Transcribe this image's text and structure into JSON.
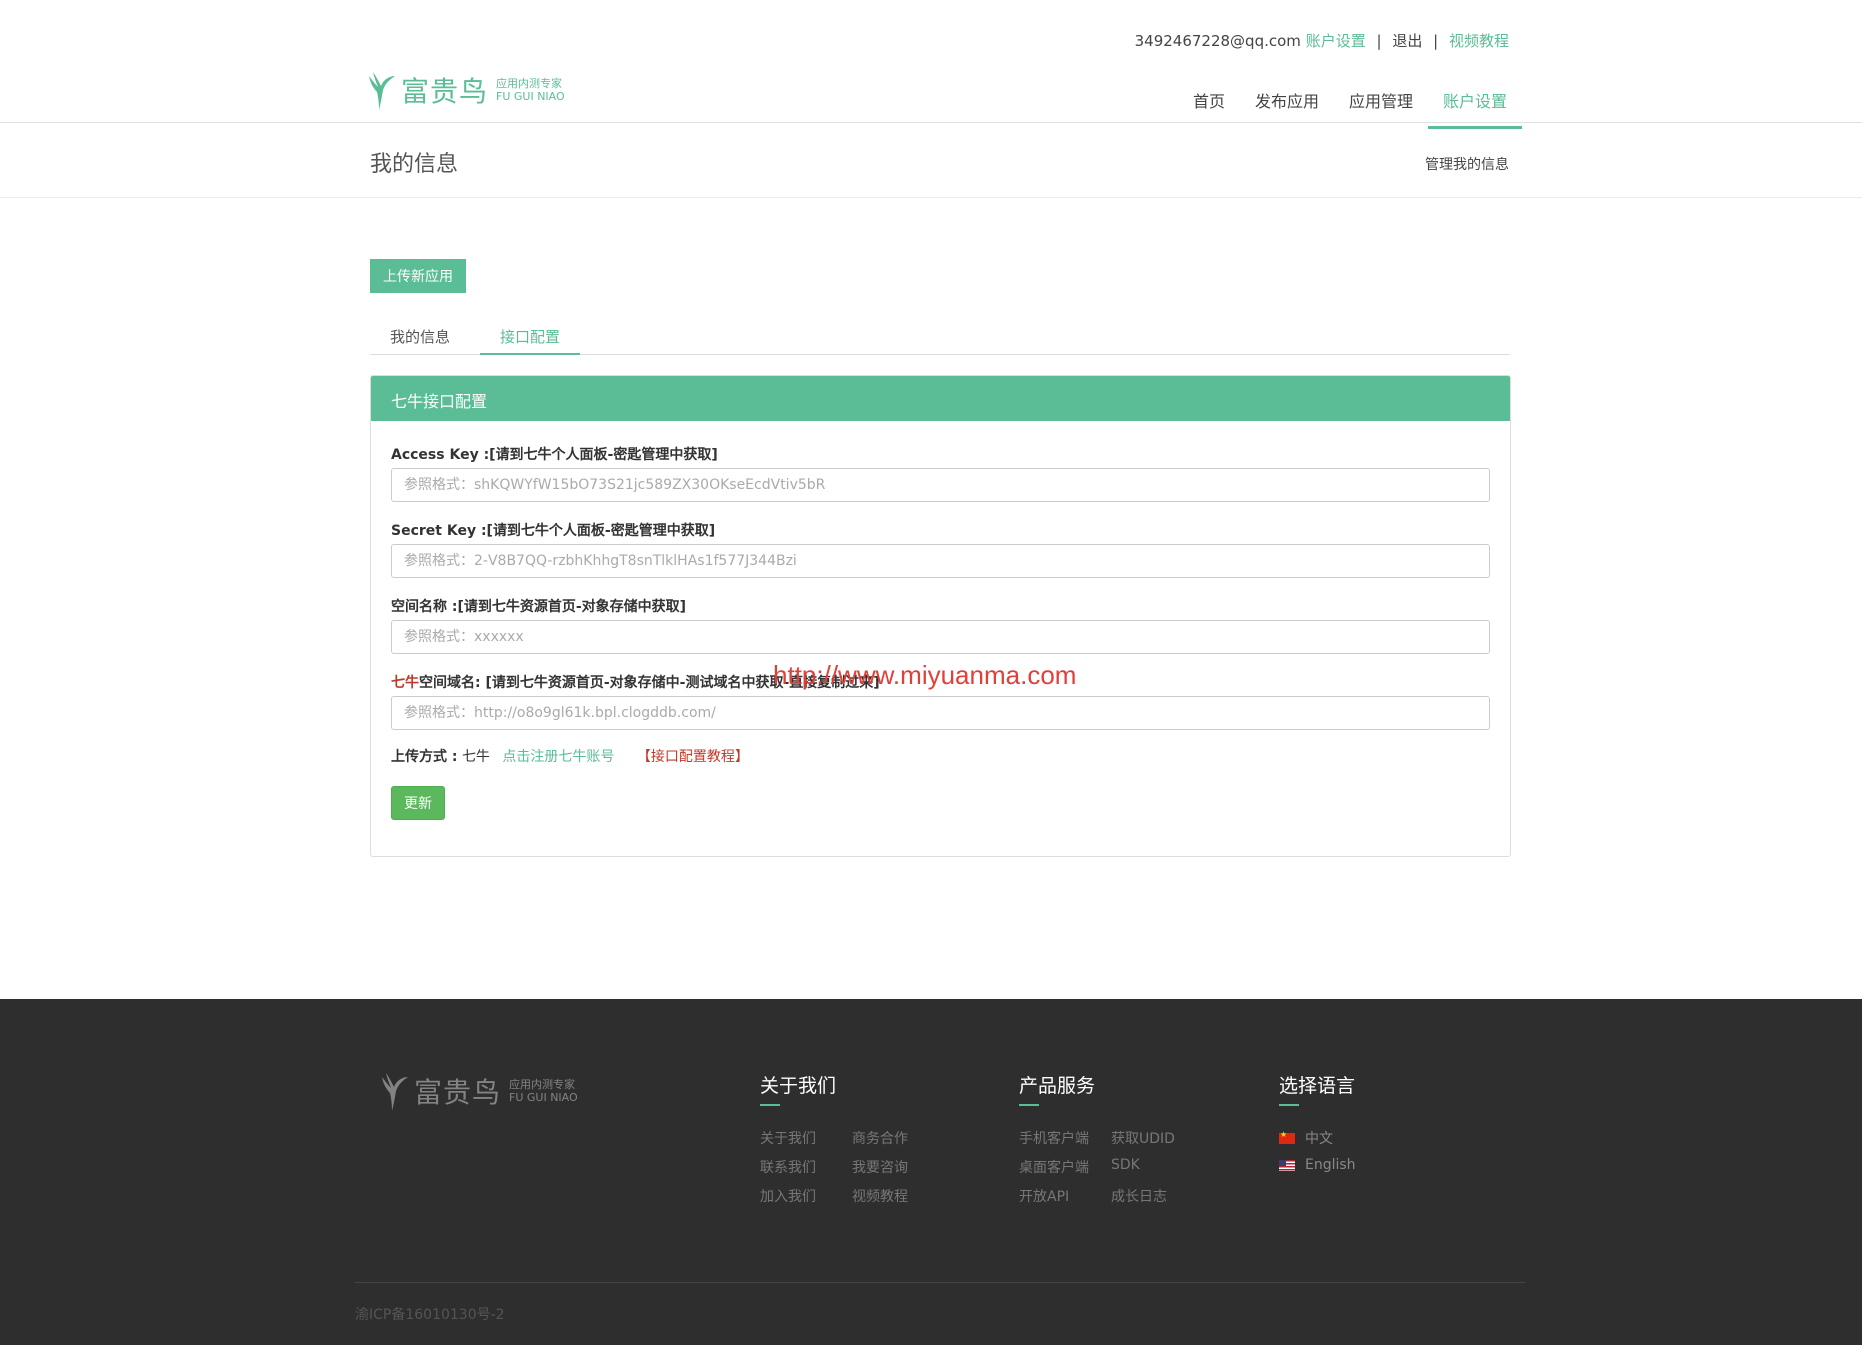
{
  "header": {
    "email": "3492467228@qq.com",
    "account_settings": "账户设置",
    "logout": "退出",
    "video_tutorial": "视频教程",
    "sep": "|",
    "brand": "富贵鸟",
    "brand_sub_cn": "应用内测专家",
    "brand_sub_en": "FU GUI NIAO"
  },
  "nav": {
    "items": [
      "首页",
      "发布应用",
      "应用管理",
      "账户设置"
    ],
    "active": "账户设置"
  },
  "page": {
    "title": "我的信息",
    "subtitle": "管理我的信息"
  },
  "upload_button": "上传新应用",
  "tabs": [
    "我的信息",
    "接口配置"
  ],
  "panel": {
    "title": "七牛接口配置",
    "fields": [
      {
        "label": "Access Key :[请到七牛个人面板-密匙管理中获取]",
        "placeholder": "参照格式：shKQWYfW15bO73S21jc589ZX30OKseEcdVtiv5bR"
      },
      {
        "label": "Secret Key :[请到七牛个人面板-密匙管理中获取]",
        "placeholder": "参照格式：2-V8B7QQ-rzbhKhhgT8snTlklHAs1f577J344Bzi"
      },
      {
        "label": "空间名称 :[请到七牛资源首页-对象存储中获取]",
        "placeholder": "参照格式：xxxxxx"
      },
      {
        "label_red": "七牛",
        "label": "空间域名: [请到七牛资源首页-对象存储中-测试域名中获取-直接复制过来]",
        "placeholder": "参照格式：http://o8o9gl61k.bpl.clogddb.com/"
      }
    ],
    "upload_method_label": "上传方式 :",
    "upload_method_value": "七牛",
    "register_link": "点击注册七牛账号",
    "tutorial_link": "【接口配置教程】",
    "update_button": "更新"
  },
  "watermark": "http://www.miyuanma.com",
  "footer": {
    "brand": "富贵鸟",
    "brand_sub_cn": "应用内测专家",
    "brand_sub_en": "FU GUI NIAO",
    "about": {
      "title": "关于我们",
      "links": [
        "关于我们",
        "商务合作",
        "联系我们",
        "我要咨询",
        "加入我们",
        "视频教程"
      ]
    },
    "products": {
      "title": "产品服务",
      "links": [
        "手机客户端",
        "获取UDID",
        "桌面客户端",
        "SDK",
        "开放API",
        "成长日志"
      ]
    },
    "language": {
      "title": "选择语言",
      "options": [
        "中文",
        "English"
      ]
    },
    "icp": "渝ICP备16010130号-2"
  },
  "colors": {
    "accent": "#5bbd95",
    "update_button": "#5cb85c",
    "footer_bg": "#2e2e2e",
    "link_red": "#c0392b"
  },
  "icons": {
    "logo": "bird-logo-icon",
    "flag_cn": "china-flag-icon",
    "flag_us": "us-flag-icon"
  }
}
